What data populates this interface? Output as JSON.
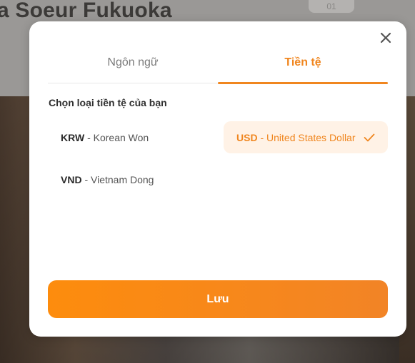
{
  "background": {
    "page_title": "a Soeur Fukuoka",
    "corner_badge": "01"
  },
  "modal": {
    "close_icon": "close-icon",
    "tabs": [
      {
        "label": "Ngôn ngữ",
        "active": false
      },
      {
        "label": "Tiền tệ",
        "active": true
      }
    ],
    "section_label": "Chọn loại tiền tệ của bạn",
    "currencies": [
      {
        "code": "KRW",
        "name": "- Korean Won",
        "selected": false
      },
      {
        "code": "USD",
        "name": "- United States Dollar",
        "selected": true
      },
      {
        "code": "VND",
        "name": "- Vietnam Dong",
        "selected": false
      }
    ],
    "save_label": "Lưu"
  },
  "colors": {
    "accent": "#f0861f",
    "selected_bg": "#fff2e6",
    "button_start": "#fd8c0d",
    "button_end": "#f28426"
  }
}
